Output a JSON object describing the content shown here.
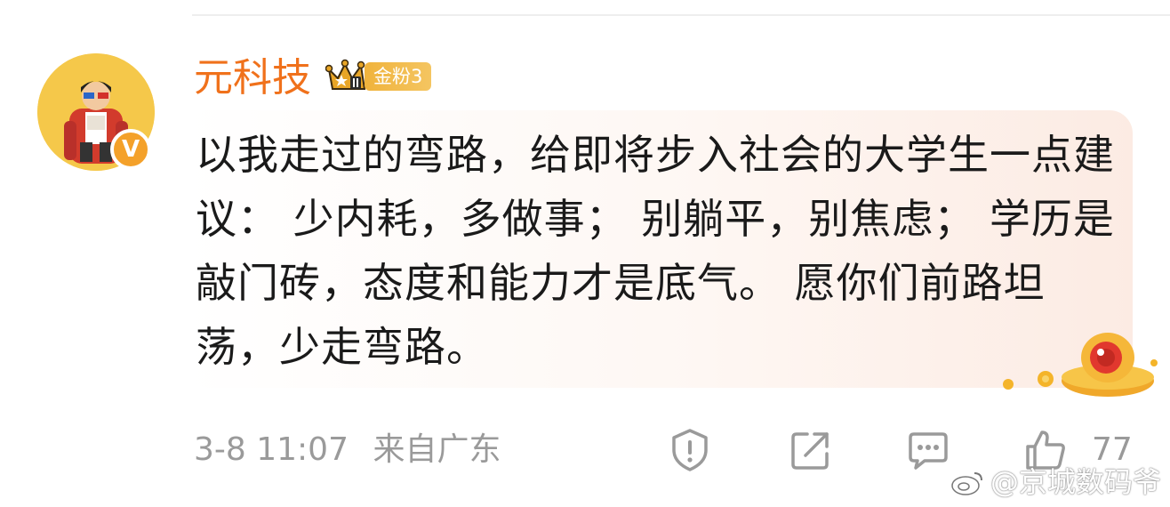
{
  "post": {
    "username": "元科技",
    "fan_badge_label": "金粉3",
    "content": "以我走过的弯路，给即将步入社会的大学生一点建议： 少内耗，多做事； 别躺平，别焦虑； 学历是敲门砖，态度和能力才是底气。 愿你们前路坦荡，少走弯路。",
    "timestamp": "3-8 11:07",
    "source": "来自广东",
    "like_count": "77"
  },
  "watermark": "@京城数码爷",
  "icons": {
    "verified": "verified-v-icon",
    "crown": "crown-icon",
    "report": "report-shield-icon",
    "share": "share-icon",
    "comment": "comment-icon",
    "like": "thumbs-up-icon",
    "decoration": "ufo-sticker-icon"
  },
  "colors": {
    "username": "#f0711b",
    "badge": "#f4a12a",
    "meta_text": "#9a9a9a",
    "body_text": "#1a1a1a"
  }
}
